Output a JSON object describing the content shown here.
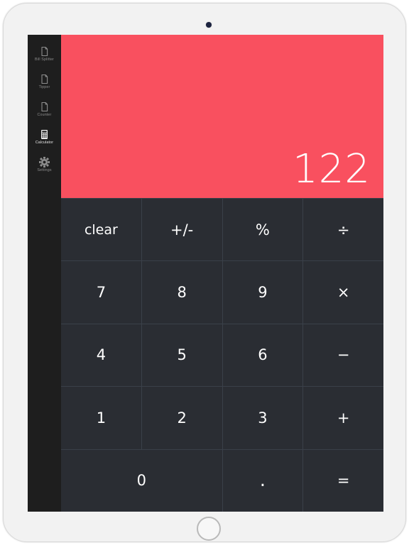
{
  "app": {
    "name": "Calculator",
    "accent_color": "#f9505f",
    "key_bg_color": "#2a2d33",
    "sidebar_bg_color": "#1e1e1e"
  },
  "sidebar": {
    "items": [
      {
        "label": "Bill Splitter",
        "icon": "document-icon",
        "active": false
      },
      {
        "label": "Tipper",
        "icon": "document-icon",
        "active": false
      },
      {
        "label": "Counter",
        "icon": "document-icon",
        "active": false
      },
      {
        "label": "Calculator",
        "icon": "calculator-icon",
        "active": true
      },
      {
        "label": "Settings",
        "icon": "gear-icon",
        "active": false
      }
    ]
  },
  "display": {
    "value": "122"
  },
  "keypad": {
    "keys": [
      {
        "label": "clear",
        "name": "key-clear",
        "kind": "word"
      },
      {
        "label": "+/-",
        "name": "key-sign",
        "kind": "op"
      },
      {
        "label": "%",
        "name": "key-percent",
        "kind": "op"
      },
      {
        "label": "÷",
        "name": "key-divide",
        "kind": "op"
      },
      {
        "label": "7",
        "name": "key-7",
        "kind": "digit"
      },
      {
        "label": "8",
        "name": "key-8",
        "kind": "digit"
      },
      {
        "label": "9",
        "name": "key-9",
        "kind": "digit"
      },
      {
        "label": "×",
        "name": "key-multiply",
        "kind": "op"
      },
      {
        "label": "4",
        "name": "key-4",
        "kind": "digit"
      },
      {
        "label": "5",
        "name": "key-5",
        "kind": "digit"
      },
      {
        "label": "6",
        "name": "key-6",
        "kind": "digit"
      },
      {
        "label": "−",
        "name": "key-subtract",
        "kind": "op"
      },
      {
        "label": "1",
        "name": "key-1",
        "kind": "digit"
      },
      {
        "label": "2",
        "name": "key-2",
        "kind": "digit"
      },
      {
        "label": "3",
        "name": "key-3",
        "kind": "digit"
      },
      {
        "label": "+",
        "name": "key-add",
        "kind": "op"
      },
      {
        "label": "0",
        "name": "key-0",
        "kind": "digit",
        "wide": true
      },
      {
        "label": ".",
        "name": "key-decimal",
        "kind": "dot"
      },
      {
        "label": "=",
        "name": "key-equals",
        "kind": "op"
      }
    ]
  },
  "device": {
    "camera": "front-camera",
    "home": "home-button"
  }
}
